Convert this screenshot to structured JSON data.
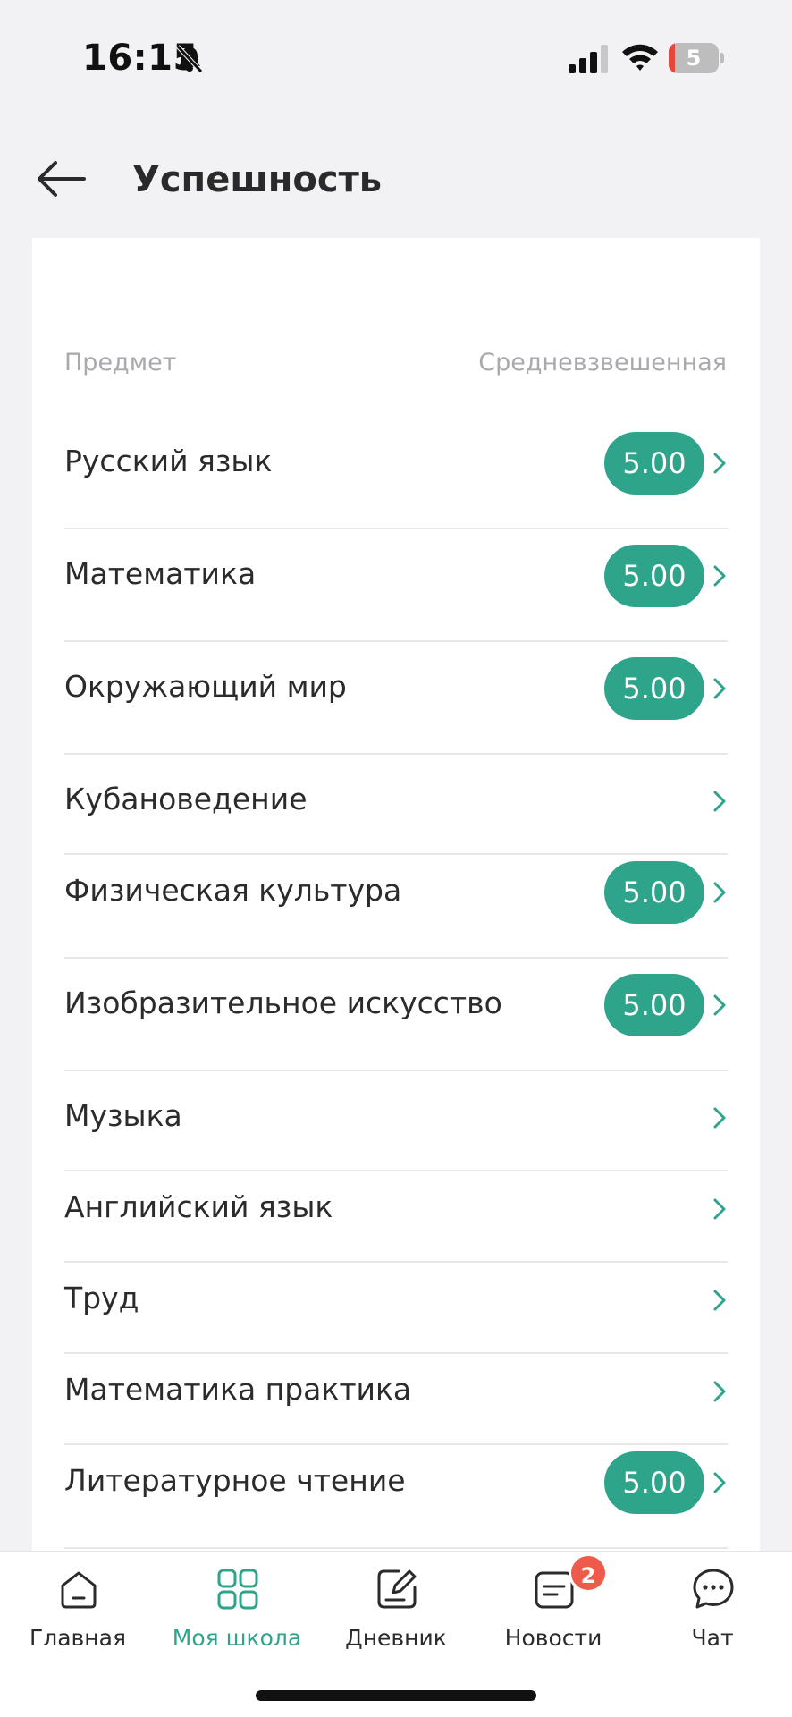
{
  "status_bar": {
    "time": "16:15",
    "battery": "5",
    "battery_percent": 5
  },
  "header": {
    "title": "Успешность"
  },
  "table": {
    "col_subject": "Предмет",
    "col_average": "Средневзвешенная"
  },
  "subjects": [
    {
      "name": "Русский язык",
      "grade": "5.00"
    },
    {
      "name": "Математика",
      "grade": "5.00"
    },
    {
      "name": "Окружающий мир",
      "grade": "5.00"
    },
    {
      "name": "Кубановедение",
      "grade": ""
    },
    {
      "name": "Физическая культура",
      "grade": "5.00"
    },
    {
      "name": "Изобразительное искусство",
      "grade": "5.00"
    },
    {
      "name": "Музыка",
      "grade": ""
    },
    {
      "name": "Английский язык",
      "grade": ""
    },
    {
      "name": "Труд",
      "grade": ""
    },
    {
      "name": "Математика практика",
      "grade": ""
    },
    {
      "name": "Литературное чтение",
      "grade": "5.00"
    }
  ],
  "tabs": [
    {
      "label": "Главная",
      "icon": "home-icon",
      "active": false
    },
    {
      "label": "Моя школа",
      "icon": "grid-icon",
      "active": true
    },
    {
      "label": "Дневник",
      "icon": "diary-icon",
      "active": false
    },
    {
      "label": "Новости",
      "icon": "news-icon",
      "active": false,
      "badge": "2"
    },
    {
      "label": "Чат",
      "icon": "chat-icon",
      "active": false
    }
  ],
  "colors": {
    "accent": "#2ea58a",
    "badge": "#ef5b4a",
    "background": "#f2f2f4"
  }
}
